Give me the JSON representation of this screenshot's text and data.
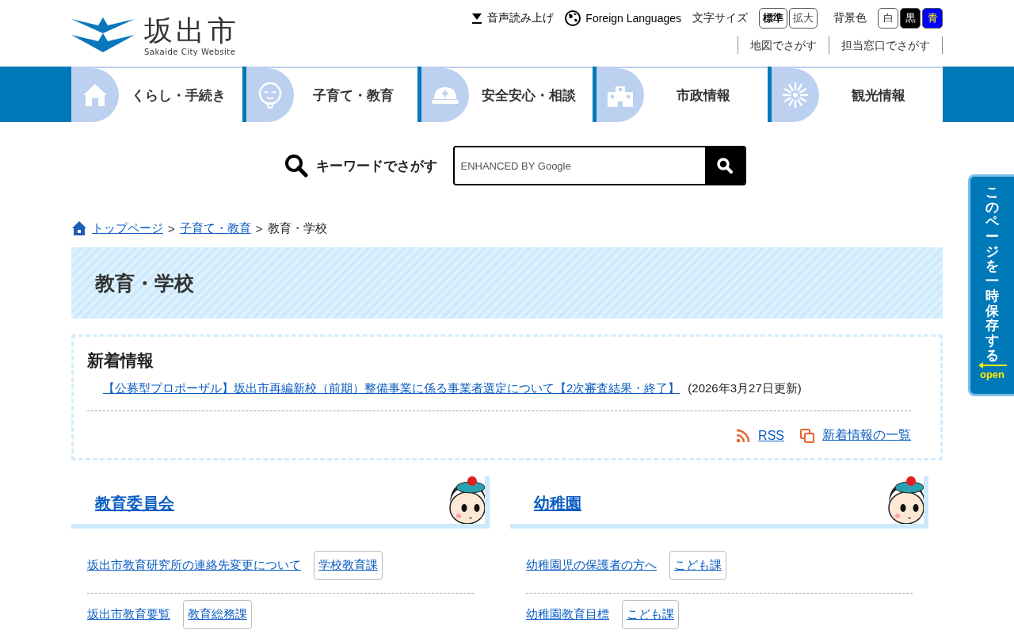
{
  "header": {
    "logo_title": "坂出市",
    "logo_subtitle": "Sakaide City Website",
    "read_aloud": "音声読み上げ",
    "foreign_languages": "Foreign Languages",
    "font_size_label": "文字サイズ",
    "font_sizes": [
      {
        "label": "標準",
        "selected": true
      },
      {
        "label": "拡大",
        "selected": false
      }
    ],
    "bg_color_label": "背景色",
    "bg_colors": [
      {
        "label": "白",
        "color": "#ffffff"
      },
      {
        "label": "黒",
        "color": "#000000"
      },
      {
        "label": "青",
        "color": "#0000ff"
      }
    ],
    "sub_links": [
      "地図でさがす",
      "担当窓口でさがす"
    ]
  },
  "nav": [
    {
      "label": "くらし・手続き",
      "kind": "house"
    },
    {
      "label": "子育て・教育",
      "kind": "baby"
    },
    {
      "label": "安全安心・相談",
      "kind": "helmet"
    },
    {
      "label": "市政情報",
      "kind": "building"
    },
    {
      "label": "観光情報",
      "kind": "firework"
    }
  ],
  "search": {
    "label": "キーワードでさがす",
    "placeholder": "ENHANCED BY Google"
  },
  "breadcrumb": {
    "separator": ">",
    "items": [
      {
        "label": "トップページ",
        "link": true
      },
      {
        "label": "子育て・教育",
        "link": true
      },
      {
        "label": "教育・学校",
        "link": false
      }
    ]
  },
  "page_title": "教育・学校",
  "news": {
    "heading": "新着情報",
    "items": [
      {
        "title": "【公募型プロポーザル】坂出市再編新校（前期）整備事業に係る事業者選定について【2次審査結果・終了】",
        "date": "(2026年3月27日更新)"
      }
    ],
    "rss": "RSS",
    "list_link": "新着情報の一覧"
  },
  "sections": [
    {
      "heading": "教育委員会",
      "items": [
        {
          "title": "坂出市教育研究所の連絡先変更について",
          "dept": "学校教育課"
        },
        {
          "title": "坂出市教育要覧",
          "dept": "教育総務課"
        }
      ]
    },
    {
      "heading": "幼稚園",
      "items": [
        {
          "title": "幼稚園児の保護者の方へ",
          "dept": "こども課"
        },
        {
          "title": "幼稚園教育目標",
          "dept": "こども課"
        }
      ]
    }
  ],
  "side_tab": {
    "label": "このページを一時保存する",
    "open": "open"
  }
}
